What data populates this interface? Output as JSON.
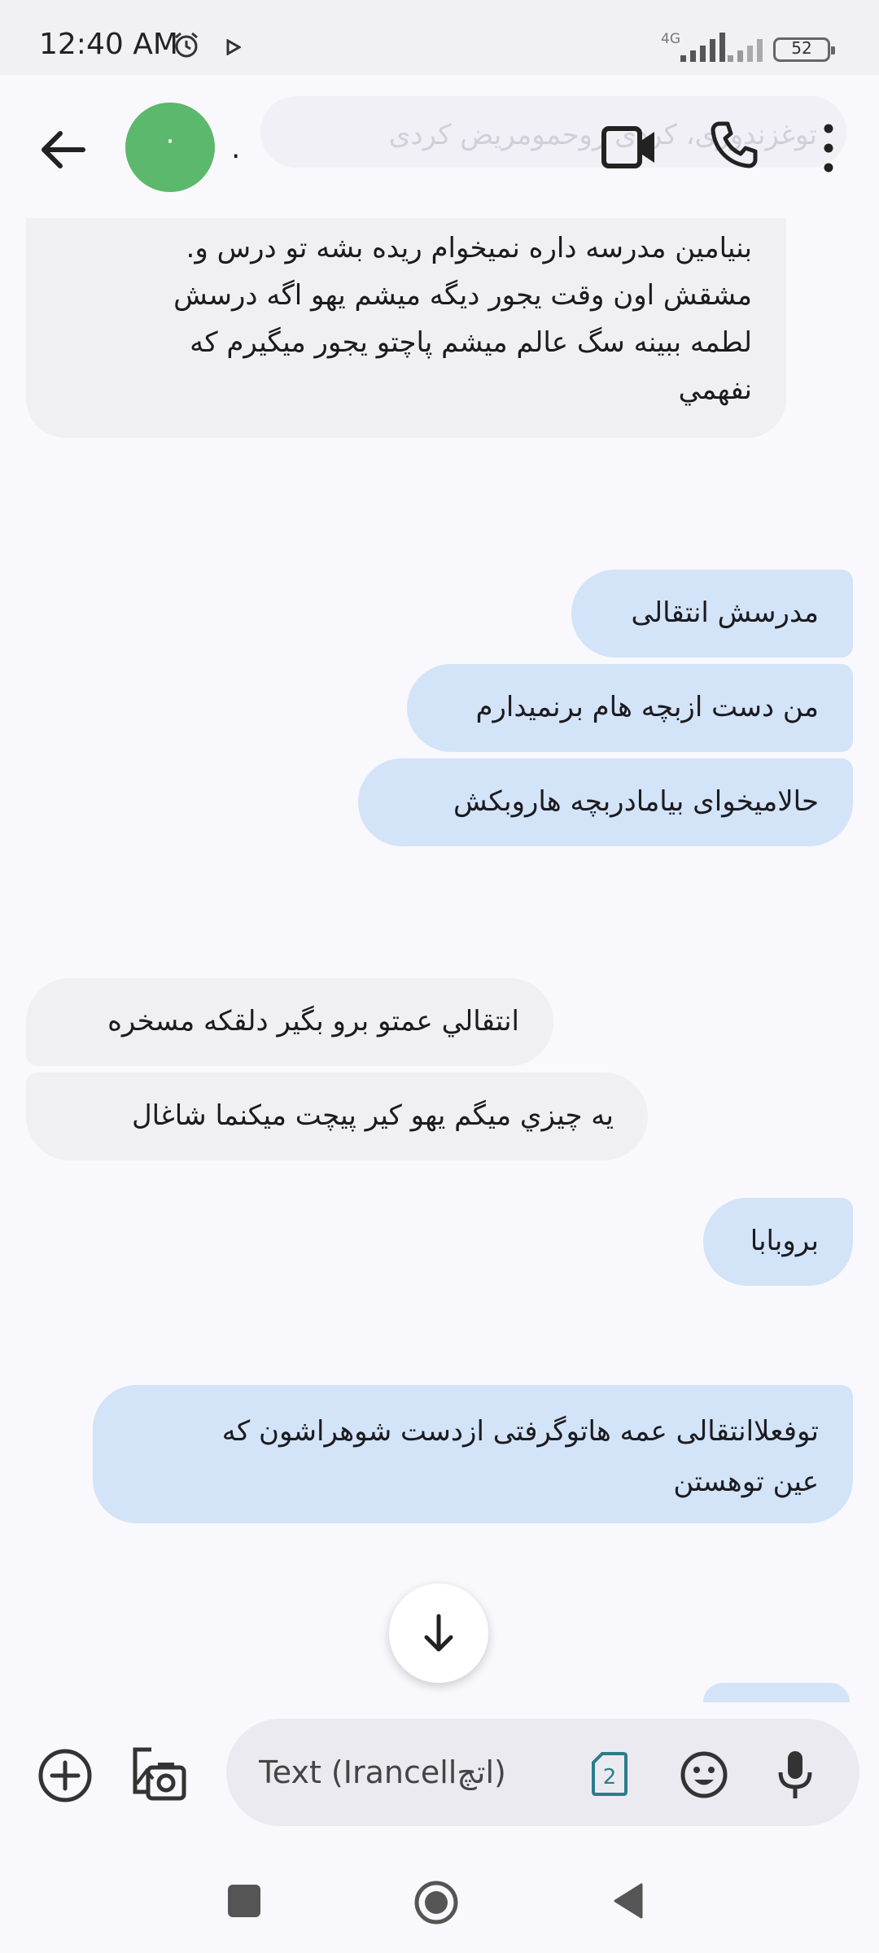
{
  "status_bar": {
    "time": "12:40 AM",
    "network": "4G",
    "battery": "52"
  },
  "header": {
    "contact_initial": "·",
    "contact_name": ".",
    "ghost_text": "توغزندوری، کردی روحمومریض کردی"
  },
  "messages": [
    {
      "direction": "incoming",
      "text": "بنیامین مدرسه داره نمیخوام ریده بشه تو درس و.\nمشقش اون وقت یجور دیگه میشم یهو اگه درسش\nلطمه ببینه سگ عالم میشم پاچتو یجور میگیرم که\nنفهمي"
    },
    {
      "direction": "outgoing",
      "text": "مدرسش انتقالی"
    },
    {
      "direction": "outgoing",
      "text": "من دست ازبچه هام برنمیدارم"
    },
    {
      "direction": "outgoing",
      "text": "حالامیخوای بیامادربچه هاروبکش"
    },
    {
      "direction": "incoming",
      "text": "انتقالي عمتو برو بگير دلقکه مسخره"
    },
    {
      "direction": "incoming",
      "text": "يه چيزي ميگم يهو کير پيچت ميکنما شاغال"
    },
    {
      "direction": "outgoing",
      "text": "بروبابا"
    },
    {
      "direction": "outgoing",
      "text": "توفعلاانتقالی عمه هاتوگرفتی ازدست شوهراشون که\nعین توهستن"
    }
  ],
  "compose": {
    "placeholder": "Text (Irancellاتچ)",
    "sim_slot": "2"
  },
  "colors": {
    "incoming_bubble": "#efeff4",
    "outgoing_bubble": "#d3e3f8",
    "avatar": "#5cb86c",
    "sim_icon": "#2a7d8a"
  }
}
